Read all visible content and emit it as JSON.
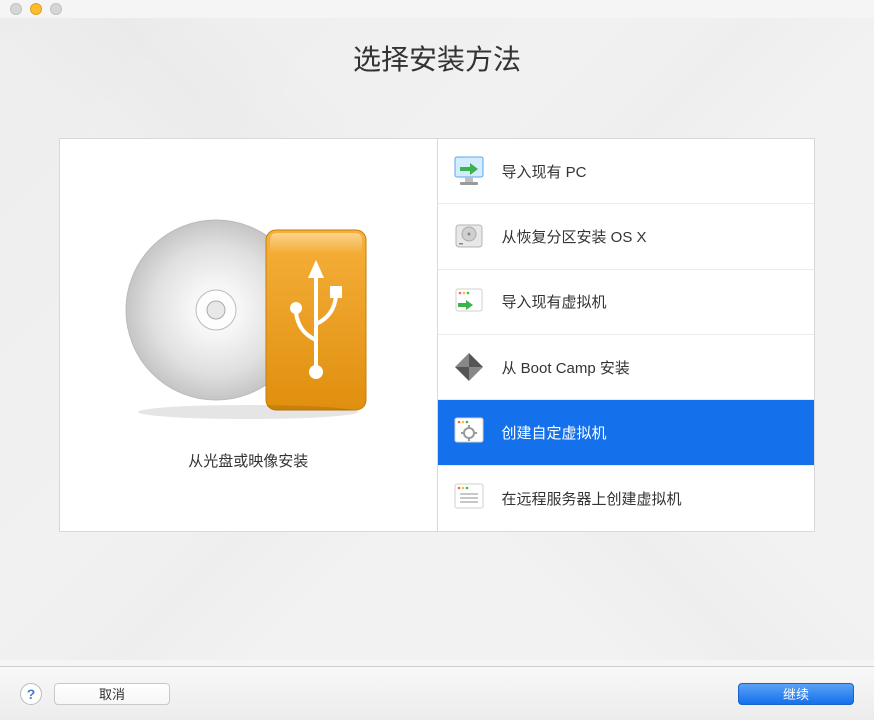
{
  "title": "选择安装方法",
  "left_panel": {
    "caption": "从光盘或映像安装"
  },
  "options": [
    {
      "id": "import-pc",
      "label": "导入现有 PC",
      "icon": "pc-import-icon"
    },
    {
      "id": "install-osx-recovery",
      "label": "从恢复分区安装 OS X",
      "icon": "hdd-icon"
    },
    {
      "id": "import-vm",
      "label": "导入现有虚拟机",
      "icon": "vm-import-icon"
    },
    {
      "id": "install-bootcamp",
      "label": "从 Boot Camp 安装",
      "icon": "bootcamp-icon"
    },
    {
      "id": "create-custom-vm",
      "label": "创建自定虚拟机",
      "icon": "custom-vm-icon"
    },
    {
      "id": "create-remote-vm",
      "label": "在远程服务器上创建虚拟机",
      "icon": "remote-vm-icon"
    }
  ],
  "selected_index": 4,
  "footer": {
    "help": "?",
    "cancel": "取消",
    "continue": "继续"
  },
  "colors": {
    "accent": "#1570eb",
    "usb_orange_light": "#f6b03b",
    "usb_orange_dark": "#e49311"
  }
}
